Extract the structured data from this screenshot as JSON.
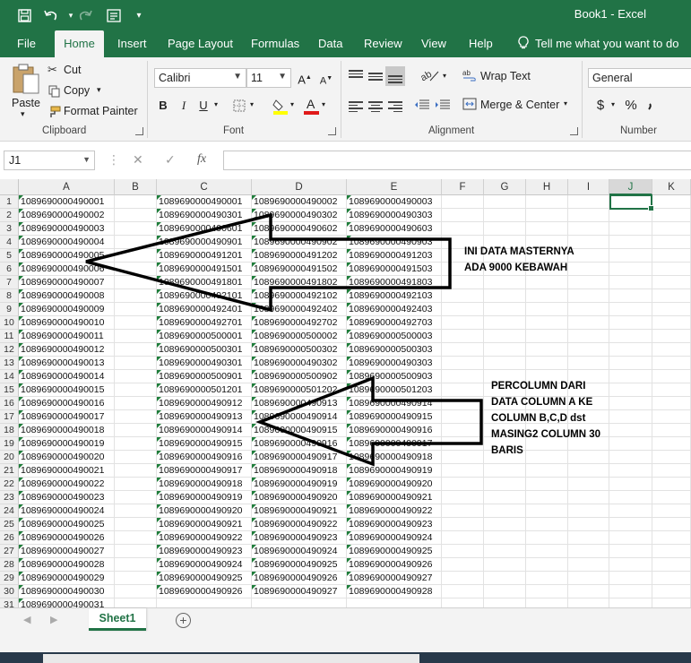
{
  "window": {
    "title": "Book1  -  Excel"
  },
  "quick_access": {
    "icons": [
      "save-icon",
      "undo-icon",
      "redo-icon",
      "quick-access-icon",
      "customize-icon"
    ]
  },
  "tabs": [
    {
      "label": "File",
      "active": false
    },
    {
      "label": "Home",
      "active": true
    },
    {
      "label": "Insert",
      "active": false
    },
    {
      "label": "Page Layout",
      "active": false
    },
    {
      "label": "Formulas",
      "active": false
    },
    {
      "label": "Data",
      "active": false
    },
    {
      "label": "Review",
      "active": false
    },
    {
      "label": "View",
      "active": false
    },
    {
      "label": "Help",
      "active": false
    },
    {
      "label": "Tell me what you want to do",
      "active": false
    }
  ],
  "ribbon": {
    "clipboard": {
      "paste": "Paste",
      "cut": "Cut",
      "copy": "Copy",
      "format_painter": "Format Painter",
      "label": "Clipboard"
    },
    "font": {
      "name": "Calibri",
      "size": "11",
      "label": "Font",
      "bold": "B",
      "italic": "I",
      "underline": "U",
      "grow": "A",
      "shrink": "A",
      "font_color": "A"
    },
    "alignment": {
      "wrap": "Wrap Text",
      "merge": "Merge & Center",
      "label": "Alignment"
    },
    "number": {
      "format": "General",
      "currency": "$",
      "percent": "%",
      "label": "Number"
    }
  },
  "formula_bar": {
    "name_box": "J1",
    "fx": "fx",
    "value": ""
  },
  "columns": [
    "A",
    "B",
    "C",
    "D",
    "E",
    "F",
    "G",
    "H",
    "I",
    "J",
    "K"
  ],
  "selected_cell": "J1",
  "rows": [
    [
      "1089690000490001",
      "",
      "1089690000490001",
      "1089690000490002",
      "1089690000490003"
    ],
    [
      "1089690000490002",
      "",
      "1089690000490301",
      "1089690000490302",
      "1089690000490303"
    ],
    [
      "1089690000490003",
      "",
      "1089690000490601",
      "1089690000490602",
      "1089690000490603"
    ],
    [
      "1089690000490004",
      "",
      "1089690000490901",
      "1089690000490902",
      "1089690000490903"
    ],
    [
      "1089690000490005",
      "",
      "1089690000491201",
      "1089690000491202",
      "1089690000491203"
    ],
    [
      "1089690000490006",
      "",
      "1089690000491501",
      "1089690000491502",
      "1089690000491503"
    ],
    [
      "1089690000490007",
      "",
      "1089690000491801",
      "1089690000491802",
      "1089690000491803"
    ],
    [
      "1089690000490008",
      "",
      "1089690000492101",
      "1089690000492102",
      "1089690000492103"
    ],
    [
      "1089690000490009",
      "",
      "1089690000492401",
      "1089690000492402",
      "1089690000492403"
    ],
    [
      "1089690000490010",
      "",
      "1089690000492701",
      "1089690000492702",
      "1089690000492703"
    ],
    [
      "1089690000490011",
      "",
      "1089690000500001",
      "1089690000500002",
      "1089690000500003"
    ],
    [
      "1089690000490012",
      "",
      "1089690000500301",
      "1089690000500302",
      "1089690000500303"
    ],
    [
      "1089690000490013",
      "",
      "1089690000490301",
      "1089690000490302",
      "1089690000490303"
    ],
    [
      "1089690000490014",
      "",
      "1089690000500901",
      "1089690000500902",
      "1089690000500903"
    ],
    [
      "1089690000490015",
      "",
      "1089690000501201",
      "1089690000501202",
      "1089690000501203"
    ],
    [
      "1089690000490016",
      "",
      "1089690000490912",
      "1089690000490913",
      "1089690000490914"
    ],
    [
      "1089690000490017",
      "",
      "1089690000490913",
      "1089690000490914",
      "1089690000490915"
    ],
    [
      "1089690000490018",
      "",
      "1089690000490914",
      "1089690000490915",
      "1089690000490916"
    ],
    [
      "1089690000490019",
      "",
      "1089690000490915",
      "1089690000490916",
      "1089690000490917"
    ],
    [
      "1089690000490020",
      "",
      "1089690000490916",
      "1089690000490917",
      "1089690000490918"
    ],
    [
      "1089690000490021",
      "",
      "1089690000490917",
      "1089690000490918",
      "1089690000490919"
    ],
    [
      "1089690000490022",
      "",
      "1089690000490918",
      "1089690000490919",
      "1089690000490920"
    ],
    [
      "1089690000490023",
      "",
      "1089690000490919",
      "1089690000490920",
      "1089690000490921"
    ],
    [
      "1089690000490024",
      "",
      "1089690000490920",
      "1089690000490921",
      "1089690000490922"
    ],
    [
      "1089690000490025",
      "",
      "1089690000490921",
      "1089690000490922",
      "1089690000490923"
    ],
    [
      "1089690000490026",
      "",
      "1089690000490922",
      "1089690000490923",
      "1089690000490924"
    ],
    [
      "1089690000490027",
      "",
      "1089690000490923",
      "1089690000490924",
      "1089690000490925"
    ],
    [
      "1089690000490028",
      "",
      "1089690000490924",
      "1089690000490925",
      "1089690000490926"
    ],
    [
      "1089690000490029",
      "",
      "1089690000490925",
      "1089690000490926",
      "1089690000490927"
    ],
    [
      "1089690000490030",
      "",
      "1089690000490926",
      "1089690000490927",
      "1089690000490928"
    ],
    [
      "1089690000490031",
      "",
      "",
      "",
      ""
    ]
  ],
  "annotations": {
    "master": [
      "INI DATA MASTERNYA",
      "ADA 9000 KEBAWAH"
    ],
    "percolumn": [
      "PERCOLUMN DARI",
      "DATA COLUMN A KE",
      "COLUMN B,C,D dst",
      "MASING2 COLUMN 30",
      "BARIS"
    ]
  },
  "sheet_tab": "Sheet1",
  "colors": {
    "excel_green": "#217346",
    "ribbon_bg": "#f3f3f3"
  }
}
